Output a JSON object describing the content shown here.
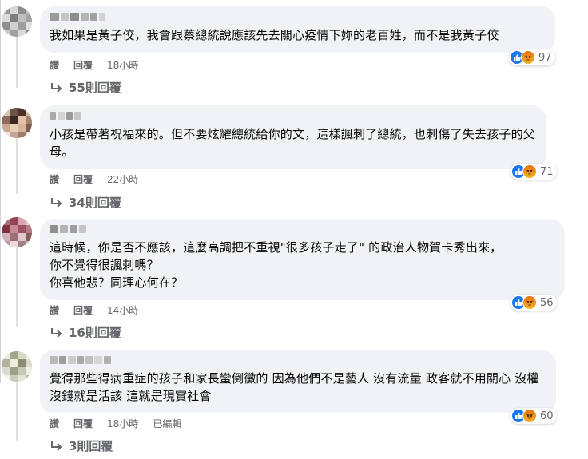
{
  "comments": [
    {
      "text": "我如果是黃子佼，我會跟蔡總統說應該先去關心疫情下妳的老百姓，而不是我黃子佼",
      "actions": [
        "讚",
        "回覆"
      ],
      "time": "18小時",
      "edited": "",
      "reaction_count": "97",
      "replies_label": "55則回覆"
    },
    {
      "text": "小孩是帶著祝福來的。但不要炫耀總統給你的文，這樣諷刺了總統，也刺傷了失去孩子的父母。",
      "actions": [
        "讚",
        "回覆"
      ],
      "time": "22小時",
      "edited": "",
      "reaction_count": "71",
      "replies_label": "34則回覆"
    },
    {
      "text": "這時候，你是否不應該，這麼高調把不重視\"很多孩子走了\" 的政治人物賀卡秀出來，\n你不覺得很諷刺嗎？\n你喜他悲？同理心何在？",
      "actions": [
        "讚",
        "回覆"
      ],
      "time": "14小時",
      "edited": "",
      "reaction_count": "56",
      "replies_label": "16則回覆"
    },
    {
      "text": "覺得那些得病重症的孩子和家長蠻倒黴的 因為他們不是藝人 沒有流量 政客就不用關心 沒權沒錢就是活該 這就是現實社會",
      "actions": [
        "讚",
        "回覆"
      ],
      "time": "18小時",
      "edited": "已編輯",
      "reaction_count": "60",
      "replies_label": "3則回覆"
    }
  ],
  "icons": {
    "like": "thumbs-up-icon",
    "angry": "angry-face-icon",
    "reply": "reply-arrow-icon"
  },
  "colors": {
    "bubble_bg": "#f0f2f5",
    "meta_text": "#65676b",
    "like_blue": "#1877f2",
    "angry_orange": "#f7b125"
  }
}
